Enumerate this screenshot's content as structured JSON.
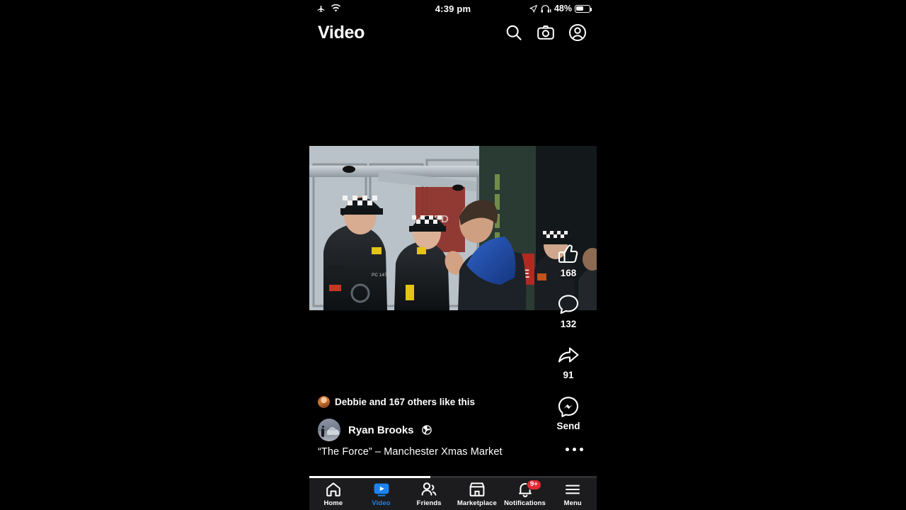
{
  "status_bar": {
    "airplane_icon": "airplane-icon",
    "wifi_icon": "wifi-icon",
    "time": "4:39 pm",
    "location_icon": "location-arrow-icon",
    "headphones_icon": "headphones-icon",
    "battery_percent": "48%",
    "battery_icon": "battery-icon"
  },
  "header": {
    "title": "Video",
    "search_icon": "search-icon",
    "camera_icon": "camera-icon",
    "profile_icon": "profile-icon"
  },
  "video": {
    "alt": "Police officers speaking with a man outside a shop entrance",
    "progress_percent": 42
  },
  "actions": {
    "like": {
      "icon": "thumbs-up-icon",
      "count": "168"
    },
    "comment": {
      "icon": "comment-icon",
      "count": "132"
    },
    "share": {
      "icon": "share-arrow-icon",
      "count": "91"
    },
    "send": {
      "icon": "messenger-icon",
      "label": "Send"
    }
  },
  "post": {
    "likes_text": "Debbie and 167 others like this",
    "author_name": "Ryan Brooks",
    "privacy_icon": "globe-icon",
    "caption": "“The Force” – Manchester Xmas Market",
    "overflow_icon": "ellipsis-icon"
  },
  "bottom_nav": [
    {
      "label": "Home",
      "icon": "home-icon",
      "active": false,
      "badge": ""
    },
    {
      "label": "Video",
      "icon": "video-icon",
      "active": true,
      "badge": ""
    },
    {
      "label": "Friends",
      "icon": "friends-icon",
      "active": false,
      "badge": ""
    },
    {
      "label": "Marketplace",
      "icon": "marketplace-icon",
      "active": false,
      "badge": ""
    },
    {
      "label": "Notifications",
      "icon": "notifications-icon",
      "active": false,
      "badge": "9+"
    },
    {
      "label": "Menu",
      "icon": "menu-icon",
      "active": false,
      "badge": ""
    }
  ],
  "colors": {
    "accent_blue": "#1b84f2",
    "badge_red": "#e22b34",
    "nav_background": "#1c1c1e",
    "page_background": "#000000"
  }
}
